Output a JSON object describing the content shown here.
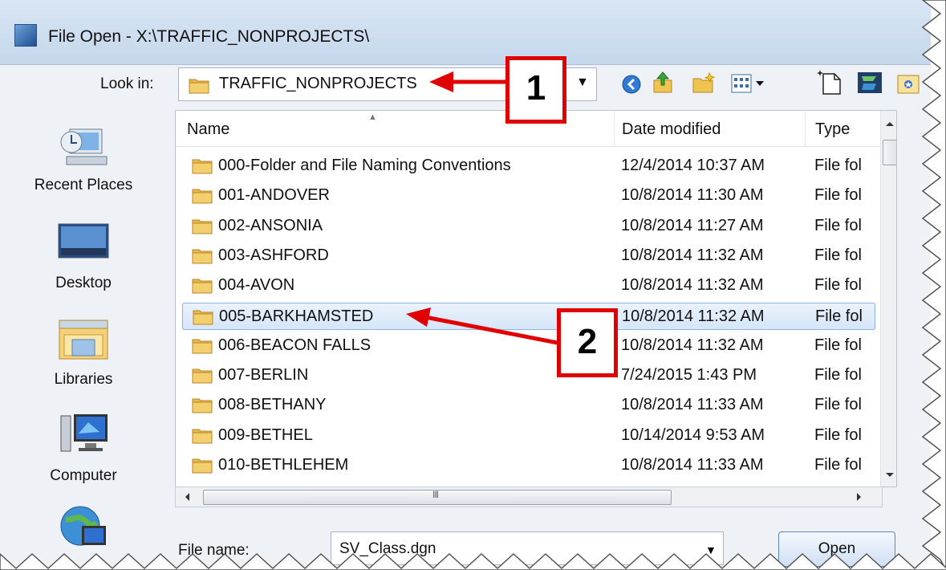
{
  "window": {
    "title": "File Open - X:\\TRAFFIC_NONPROJECTS\\"
  },
  "look_in": {
    "label": "Look in:",
    "value": "TRAFFIC_NONPROJECTS"
  },
  "toolbar": {
    "icons": [
      "back-icon",
      "up-folder-icon",
      "new-folder-icon",
      "views-menu-icon",
      "new-file-icon",
      "workset-icon",
      "folder-favorite-icon"
    ]
  },
  "sidebar": {
    "items": [
      {
        "label": "Recent Places",
        "icon": "recent-places-icon"
      },
      {
        "label": "Desktop",
        "icon": "desktop-icon"
      },
      {
        "label": "Libraries",
        "icon": "libraries-icon"
      },
      {
        "label": "Computer",
        "icon": "computer-icon"
      },
      {
        "label": "",
        "icon": "network-icon"
      }
    ]
  },
  "list": {
    "columns": {
      "name": "Name",
      "date": "Date modified",
      "type": "Type"
    },
    "rows": [
      {
        "name": "000-Folder and File Naming Conventions",
        "date": "12/4/2014 10:37 AM",
        "type": "File fol"
      },
      {
        "name": "001-ANDOVER",
        "date": "10/8/2014 11:30 AM",
        "type": "File fol"
      },
      {
        "name": "002-ANSONIA",
        "date": "10/8/2014 11:27 AM",
        "type": "File fol"
      },
      {
        "name": "003-ASHFORD",
        "date": "10/8/2014 11:32 AM",
        "type": "File fol"
      },
      {
        "name": "004-AVON",
        "date": "10/8/2014 11:32 AM",
        "type": "File fol"
      },
      {
        "name": "005-BARKHAMSTED",
        "date": "10/8/2014 11:32 AM",
        "type": "File fol",
        "selected": true
      },
      {
        "name": "006-BEACON FALLS",
        "date": "10/8/2014 11:32 AM",
        "type": "File fol"
      },
      {
        "name": "007-BERLIN",
        "date": "7/24/2015 1:43 PM",
        "type": "File fol"
      },
      {
        "name": "008-BETHANY",
        "date": "10/8/2014 11:33 AM",
        "type": "File fol"
      },
      {
        "name": "009-BETHEL",
        "date": "10/14/2014 9:53 AM",
        "type": "File fol"
      },
      {
        "name": "010-BETHLEHEM",
        "date": "10/8/2014 11:33 AM",
        "type": "File fol"
      }
    ]
  },
  "hscroll": {
    "grip": "III"
  },
  "file_name": {
    "label": "File name:",
    "value": "SV_Class.dgn"
  },
  "buttons": {
    "open": "Open"
  },
  "callouts": [
    {
      "number": "1"
    },
    {
      "number": "2"
    }
  ],
  "colors": {
    "callout_red": "#e00000",
    "selection": "#d6e6f8",
    "folder": "#e8b94a"
  }
}
